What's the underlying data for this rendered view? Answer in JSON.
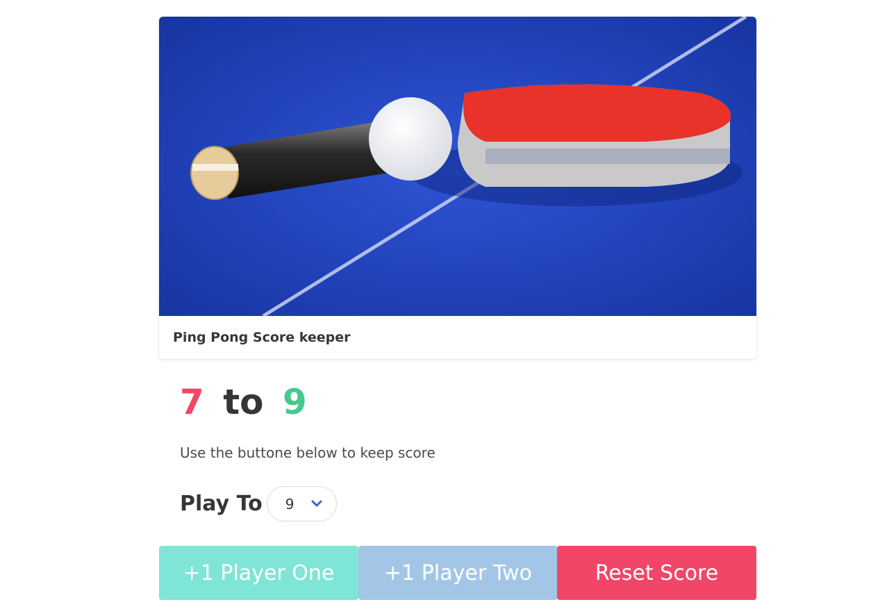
{
  "card": {
    "title": "Ping Pong Score keeper"
  },
  "score": {
    "player_one": "7",
    "separator": "to",
    "player_two": "9"
  },
  "hint": "Use the buttone below to keep score",
  "play_to": {
    "label": "Play To",
    "selected": "9"
  },
  "buttons": {
    "player_one": "+1 Player One",
    "player_two": "+1 Player Two",
    "reset": "Reset Score"
  },
  "colors": {
    "player_one": "#f14668",
    "player_two": "#48c78e",
    "button_one": "#7fe5d6",
    "button_two": "#a3c6e6",
    "button_reset": "#f14668"
  }
}
